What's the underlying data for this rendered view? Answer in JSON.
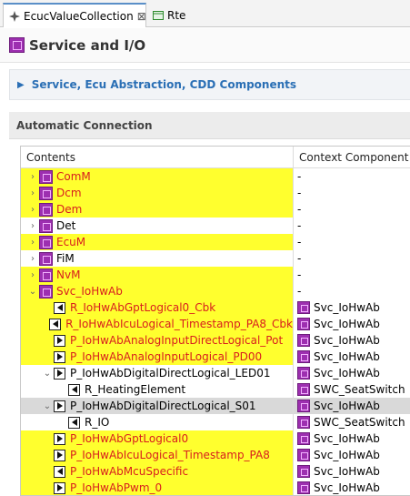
{
  "tabs": [
    {
      "label": "EcucValueCollection",
      "close": "⊠"
    },
    {
      "label": "Rte"
    }
  ],
  "header": {
    "title": "Service and I/O"
  },
  "section_collapsed": {
    "title": "Service, Ecu Abstraction, CDD Components"
  },
  "section_auto": {
    "title": "Automatic Connection"
  },
  "tree": {
    "columns": [
      "Contents",
      "Context Component"
    ],
    "rows": [
      {
        "indent": 0,
        "expander": "›",
        "icon": "element",
        "label": "ComM",
        "context": "-",
        "hl": true,
        "red": true
      },
      {
        "indent": 0,
        "expander": "›",
        "icon": "element",
        "label": "Dcm",
        "context": "-",
        "hl": true,
        "red": true
      },
      {
        "indent": 0,
        "expander": "›",
        "icon": "element",
        "label": "Dem",
        "context": "-",
        "hl": true,
        "red": true
      },
      {
        "indent": 0,
        "expander": "›",
        "icon": "element",
        "label": "Det",
        "context": "-",
        "hl": false,
        "red": false
      },
      {
        "indent": 0,
        "expander": "›",
        "icon": "element",
        "label": "EcuM",
        "context": "-",
        "hl": true,
        "red": true
      },
      {
        "indent": 0,
        "expander": "›",
        "icon": "element",
        "label": "FiM",
        "context": "-",
        "hl": false,
        "red": false
      },
      {
        "indent": 0,
        "expander": "›",
        "icon": "element",
        "label": "NvM",
        "context": "-",
        "hl": true,
        "red": true
      },
      {
        "indent": 0,
        "expander": "⌄",
        "icon": "element",
        "label": "Svc_IoHwAb",
        "context": "-",
        "hl": true,
        "red": true
      },
      {
        "indent": 1,
        "expander": "",
        "icon": "require",
        "label": "R_IoHwAbGptLogical0_Cbk",
        "context": "Svc_IoHwAb",
        "ctxicon": true,
        "hl": true,
        "red": true
      },
      {
        "indent": 1,
        "expander": "",
        "icon": "require",
        "label": "R_IoHwAbIcuLogical_Timestamp_PA8_Cbk",
        "context": "Svc_IoHwAb",
        "ctxicon": true,
        "hl": true,
        "red": true
      },
      {
        "indent": 1,
        "expander": "",
        "icon": "provide",
        "label": "P_IoHwAbAnalogInputDirectLogical_Pot",
        "context": "Svc_IoHwAb",
        "ctxicon": true,
        "hl": true,
        "red": true
      },
      {
        "indent": 1,
        "expander": "",
        "icon": "provide",
        "label": "P_IoHwAbAnalogInputLogical_PD00",
        "context": "Svc_IoHwAb",
        "ctxicon": true,
        "hl": true,
        "red": true
      },
      {
        "indent": 1,
        "expander": "⌄",
        "icon": "provide",
        "label": "P_IoHwAbDigitalDirectLogical_LED01",
        "context": "Svc_IoHwAb",
        "ctxicon": true,
        "hl": false,
        "red": false
      },
      {
        "indent": 2,
        "expander": "",
        "icon": "require",
        "label": "R_HeatingElement",
        "context": "SWC_SeatSwitch",
        "ctxicon": true,
        "hl": false,
        "red": false
      },
      {
        "indent": 1,
        "expander": "⌄",
        "icon": "provide",
        "label": "P_IoHwAbDigitalDirectLogical_S01",
        "context": "Svc_IoHwAb",
        "ctxicon": true,
        "hl": false,
        "red": false,
        "selected": true
      },
      {
        "indent": 2,
        "expander": "",
        "icon": "require",
        "label": "R_IO",
        "context": "SWC_SeatSwitch",
        "ctxicon": true,
        "hl": false,
        "red": false
      },
      {
        "indent": 1,
        "expander": "",
        "icon": "provide",
        "label": "P_IoHwAbGptLogical0",
        "context": "Svc_IoHwAb",
        "ctxicon": true,
        "hl": true,
        "red": true
      },
      {
        "indent": 1,
        "expander": "",
        "icon": "provide",
        "label": "P_IoHwAbIcuLogical_Timestamp_PA8",
        "context": "Svc_IoHwAb",
        "ctxicon": true,
        "hl": true,
        "red": true
      },
      {
        "indent": 1,
        "expander": "",
        "icon": "require",
        "label": "P_IoHwAbMcuSpecific",
        "context": "Svc_IoHwAb",
        "ctxicon": true,
        "hl": true,
        "red": true
      },
      {
        "indent": 1,
        "expander": "",
        "icon": "provide",
        "label": "P_IoHwAbPwm_0",
        "context": "Svc_IoHwAb",
        "ctxicon": true,
        "hl": true,
        "red": true
      }
    ]
  }
}
